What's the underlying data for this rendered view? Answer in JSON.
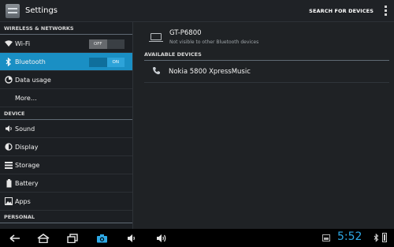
{
  "actionbar": {
    "title": "Settings",
    "search_label": "SEARCH FOR DEVICES"
  },
  "sidebar": {
    "sections": [
      {
        "header": "WIRELESS & NETWORKS",
        "items": [
          {
            "label": "Wi-Fi",
            "icon": "wifi-icon",
            "toggle": {
              "state": "off",
              "off_label": "OFF"
            }
          },
          {
            "label": "Bluetooth",
            "icon": "bluetooth-icon",
            "selected": true,
            "toggle": {
              "state": "on",
              "on_label": "ON"
            }
          },
          {
            "label": "Data usage",
            "icon": "data-usage-icon"
          },
          {
            "label": "More…",
            "icon": ""
          }
        ]
      },
      {
        "header": "DEVICE",
        "items": [
          {
            "label": "Sound",
            "icon": "speaker-icon"
          },
          {
            "label": "Display",
            "icon": "brightness-icon"
          },
          {
            "label": "Storage",
            "icon": "storage-icon"
          },
          {
            "label": "Battery",
            "icon": "battery-icon"
          },
          {
            "label": "Apps",
            "icon": "apps-icon"
          }
        ]
      },
      {
        "header": "PERSONAL",
        "items": []
      }
    ]
  },
  "bluetooth": {
    "this_device": {
      "name": "GT-P6800",
      "visibility": "Not visible to other Bluetooth devices"
    },
    "available_header": "AVAILABLE DEVICES",
    "available_devices": [
      {
        "name": "Nokia 5800 XpressMusic",
        "icon": "phone-icon"
      }
    ]
  },
  "statusbar": {
    "time": "5:52"
  },
  "colors": {
    "accent": "#1a8fc4",
    "clock": "#2ea9e6"
  }
}
